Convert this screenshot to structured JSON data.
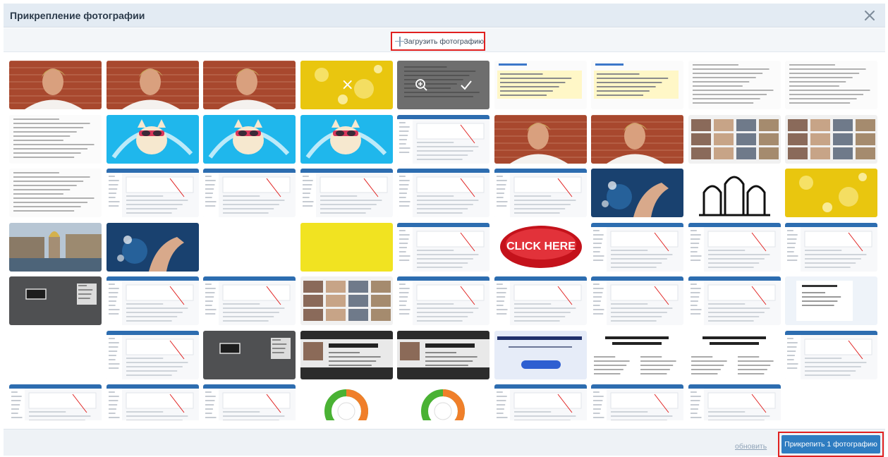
{
  "dialog": {
    "title": "Прикрепление фотографии",
    "close_icon": "close-icon"
  },
  "toolbar": {
    "upload_label": "Загрузить фотографию",
    "upload_icon": "plus-icon"
  },
  "overlay": {
    "delete_glyph": "×",
    "zoom_icon": "zoom-in-icon",
    "check_icon": "checkmark-icon"
  },
  "tiles": [
    {
      "kind": "person"
    },
    {
      "kind": "person"
    },
    {
      "kind": "person"
    },
    {
      "kind": "yellow",
      "overlay": "delete"
    },
    {
      "kind": "selected"
    },
    {
      "kind": "doc-yellow"
    },
    {
      "kind": "doc-yellow"
    },
    {
      "kind": "doc"
    },
    {
      "kind": "doc"
    },
    {
      "kind": "doc"
    },
    {
      "kind": "cartoon"
    },
    {
      "kind": "cartoon"
    },
    {
      "kind": "cartoon"
    },
    {
      "kind": "ui"
    },
    {
      "kind": "person"
    },
    {
      "kind": "person"
    },
    {
      "kind": "photo-mix"
    },
    {
      "kind": "photo-mix"
    },
    {
      "kind": "doc"
    },
    {
      "kind": "ui"
    },
    {
      "kind": "ui"
    },
    {
      "kind": "ui"
    },
    {
      "kind": "ui"
    },
    {
      "kind": "ui"
    },
    {
      "kind": "hand"
    },
    {
      "kind": "church"
    },
    {
      "kind": "yellow"
    },
    {
      "kind": "city"
    },
    {
      "kind": "hand"
    },
    {
      "kind": "blank"
    },
    {
      "kind": "yellow-flat"
    },
    {
      "kind": "ui"
    },
    {
      "kind": "click"
    },
    {
      "kind": "ui"
    },
    {
      "kind": "ui"
    },
    {
      "kind": "ui"
    },
    {
      "kind": "ui-dark"
    },
    {
      "kind": "ui"
    },
    {
      "kind": "ui"
    },
    {
      "kind": "photo-mix"
    },
    {
      "kind": "ui"
    },
    {
      "kind": "ui"
    },
    {
      "kind": "ui"
    },
    {
      "kind": "ui"
    },
    {
      "kind": "slide"
    },
    {
      "kind": "blank"
    },
    {
      "kind": "ui"
    },
    {
      "kind": "ui-dark"
    },
    {
      "kind": "webinar"
    },
    {
      "kind": "webinar"
    },
    {
      "kind": "promo"
    },
    {
      "kind": "cert"
    },
    {
      "kind": "cert"
    },
    {
      "kind": "ui"
    },
    {
      "kind": "ui"
    },
    {
      "kind": "ui"
    },
    {
      "kind": "ui"
    },
    {
      "kind": "donut"
    },
    {
      "kind": "donut"
    },
    {
      "kind": "ui"
    },
    {
      "kind": "ui"
    },
    {
      "kind": "ui"
    }
  ],
  "footer": {
    "refresh_label": "обновить",
    "attach_label": "Прикрепить 1 фотографию"
  }
}
